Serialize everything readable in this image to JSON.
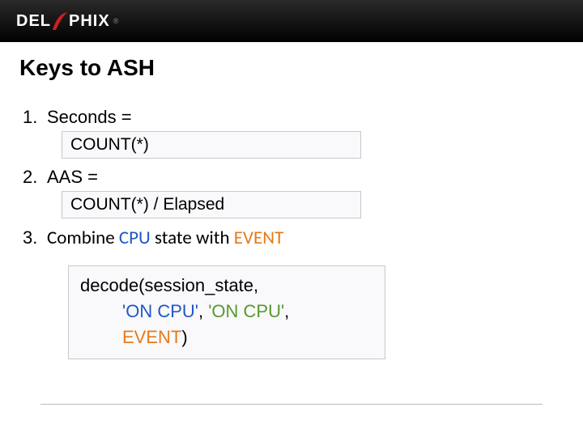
{
  "header": {
    "brand_prefix": "DEL",
    "brand_suffix": "PHIX"
  },
  "title": "Keys to ASH",
  "items": {
    "one": {
      "num": "1.",
      "label": "Seconds ="
    },
    "box1": "COUNT(*)",
    "two": {
      "num": "2.",
      "label": "AAS ="
    },
    "box2": "COUNT(*) / Elapsed",
    "three": {
      "num": "3.",
      "pre": "Combine ",
      "cpu": "CPU",
      "mid": " state with ",
      "event": "EVENT"
    }
  },
  "code": {
    "l1": "decode(session_state,",
    "l2a": "'ON CPU'",
    "l2b": ", ",
    "l2c": "'ON CPU'",
    "l2d": ",",
    "l3a": "EVENT",
    "l3b": ")"
  }
}
